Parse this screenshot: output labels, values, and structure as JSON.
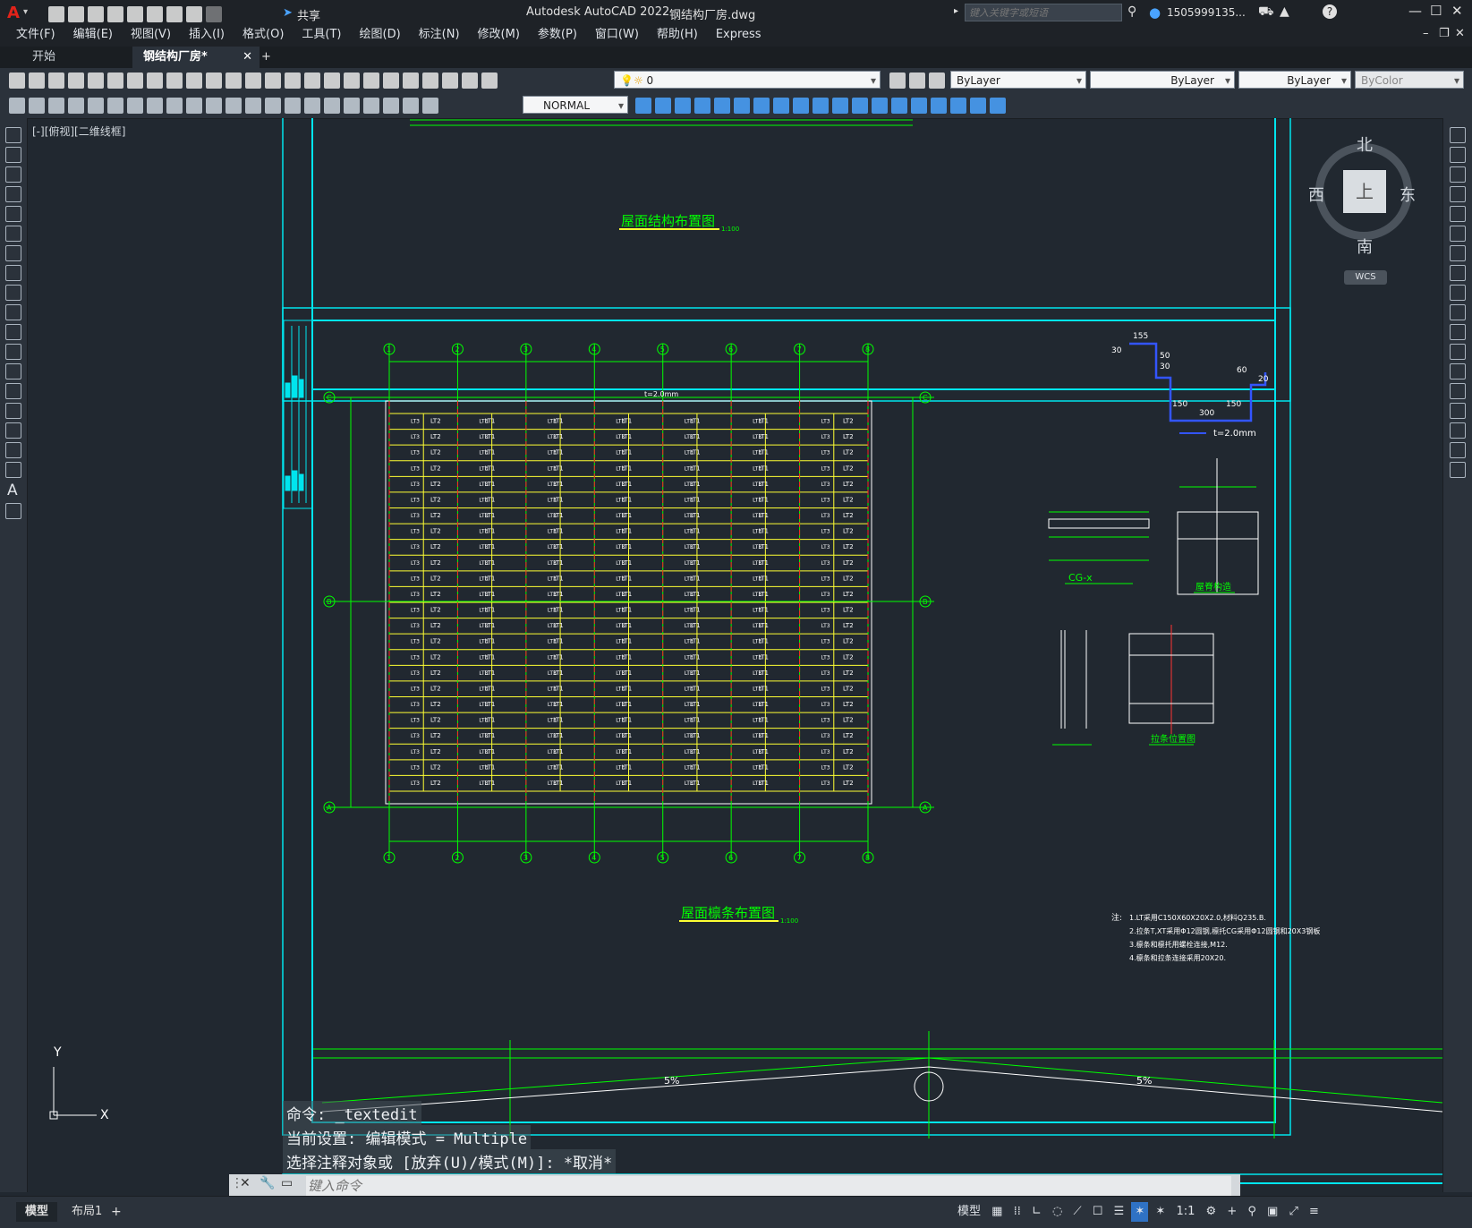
{
  "app": {
    "logo": "A",
    "title": "Autodesk AutoCAD 2022",
    "filename": "钢结构厂房.dwg",
    "share_label": "共享",
    "search_placeholder": "键入关键字或短语",
    "user": "1505999135...",
    "help": "?"
  },
  "menu": [
    "文件(F)",
    "编辑(E)",
    "视图(V)",
    "插入(I)",
    "格式(O)",
    "工具(T)",
    "绘图(D)",
    "标注(N)",
    "修改(M)",
    "参数(P)",
    "窗口(W)",
    "帮助(H)",
    "Express"
  ],
  "tabs": [
    {
      "label": "开始"
    },
    {
      "label": "钢结构厂房*",
      "close": "✕"
    }
  ],
  "tab_add": "+",
  "toolbar": {
    "layer": "0",
    "color": "ByLayer",
    "linetype": "ByLayer",
    "lineweight": "ByLayer",
    "plotstyle": "ByColor",
    "textstyle": "NORMAL"
  },
  "viewport_label": "[-][俯视][二维线框]",
  "viewcube": {
    "north": "北",
    "south": "南",
    "east": "东",
    "west": "西",
    "top": "上",
    "wcs": "WCS"
  },
  "drawing": {
    "title_top": "屋面结构布置图",
    "title_top_scale": "1:100",
    "title_main": "屋面檩条布置图",
    "title_main_scale": "1:100",
    "purlin_a": "LT1",
    "purlin_b": "LT2",
    "purlin_c": "LT3",
    "thickness_top": "t=2.0mm",
    "detail_cg": "CG-x",
    "detail_roof": "屋脊构造",
    "detail_tie": "拉条位置图",
    "section_t": "t=2.0mm",
    "dims": {
      "d1": "155",
      "d2": "50",
      "d3": "30",
      "d4": "30",
      "d5": "150",
      "d6": "300",
      "d7": "150",
      "d8": "60",
      "d9": "20"
    },
    "notes": [
      "注:",
      "1.LT采用C150X60X20X2.0,材料Q235.B.",
      "2.拉条T,XT采用Φ12圆钢,檩托CG采用Φ12圆钢和20X3钢板",
      "3.檩条和檩托用螺栓连接,M12.",
      "4.檩条和拉条连接采用20X20."
    ],
    "slope1": "5%",
    "slope2": "5%",
    "axis_nums": [
      "1",
      "2",
      "3",
      "4",
      "5",
      "6",
      "7",
      "8"
    ],
    "axis_letters": [
      "C",
      "B",
      "A"
    ]
  },
  "command": {
    "line1": "命令: _textedit",
    "line2": "当前设置: 编辑模式 = Multiple",
    "line3": "选择注释对象或 [放弃(U)/模式(M)]: *取消*",
    "placeholder": "键入命令"
  },
  "layout_tabs": [
    "模型",
    "布局1"
  ],
  "layout_add": "+",
  "status": {
    "model": "模型",
    "scale": "1:1"
  },
  "ucs": {
    "x": "X",
    "y": "Y"
  },
  "colors": {
    "accent": "#00e5ee",
    "grid": "#00ff00",
    "purlin": "#ffff33",
    "bg": "#212830"
  }
}
